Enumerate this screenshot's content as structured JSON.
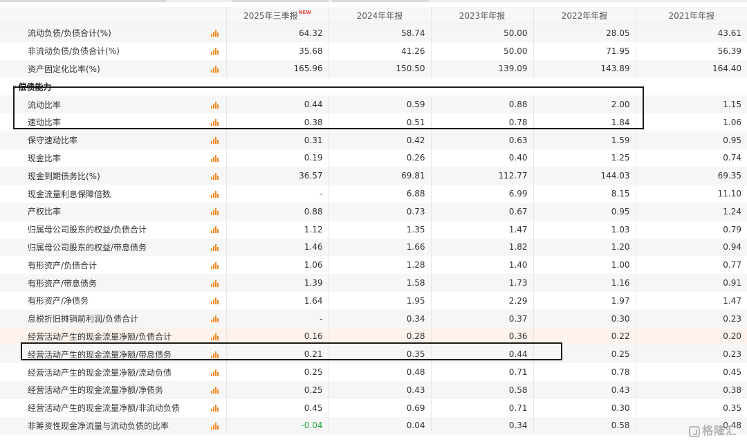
{
  "header": {
    "columns": [
      "2025年三季报",
      "2024年年报",
      "2023年年报",
      "2022年年报",
      "2021年年报"
    ],
    "new_badge": "NEW"
  },
  "section_label": "偿债能力",
  "icons": {
    "row_chart": "bar-chart-icon",
    "section_toggle": "chevron-down-icon"
  },
  "colors": {
    "chart_icon": "#f08a24",
    "negative": "#22a344",
    "new_badge": "#e6483d",
    "highlight_row": "#fdf3ec"
  },
  "watermark": "格隆汇",
  "rows_before": [
    {
      "name": "流动负债/负债合计(%)",
      "values": [
        "64.32",
        "58.74",
        "50.00",
        "28.05",
        "43.61"
      ]
    },
    {
      "name": "非流动负债/负债合计(%)",
      "values": [
        "35.68",
        "41.26",
        "50.00",
        "71.95",
        "56.39"
      ]
    },
    {
      "name": "资产固定化比率(%)",
      "values": [
        "165.96",
        "150.50",
        "139.09",
        "143.89",
        "164.40"
      ]
    }
  ],
  "rows_after": [
    {
      "name": "流动比率",
      "values": [
        "0.44",
        "0.59",
        "0.88",
        "2.00",
        "1.15"
      ]
    },
    {
      "name": "速动比率",
      "values": [
        "0.38",
        "0.51",
        "0.78",
        "1.84",
        "1.06"
      ]
    },
    {
      "name": "保守速动比率",
      "values": [
        "0.31",
        "0.42",
        "0.63",
        "1.59",
        "0.95"
      ]
    },
    {
      "name": "现金比率",
      "values": [
        "0.19",
        "0.26",
        "0.40",
        "1.25",
        "0.74"
      ]
    },
    {
      "name": "现金到期债务比(%)",
      "values": [
        "36.57",
        "69.81",
        "112.77",
        "144.03",
        "69.35"
      ]
    },
    {
      "name": "现金流量利息保障倍数",
      "values": [
        "-",
        "6.88",
        "6.99",
        "8.15",
        "11.10"
      ]
    },
    {
      "name": "产权比率",
      "values": [
        "0.88",
        "0.73",
        "0.67",
        "0.95",
        "1.24"
      ]
    },
    {
      "name": "归属母公司股东的权益/负债合计",
      "values": [
        "1.12",
        "1.35",
        "1.47",
        "1.03",
        "0.79"
      ]
    },
    {
      "name": "归属母公司股东的权益/带息债务",
      "values": [
        "1.46",
        "1.66",
        "1.82",
        "1.20",
        "0.94"
      ]
    },
    {
      "name": "有形资产/负债合计",
      "values": [
        "1.06",
        "1.28",
        "1.40",
        "1.00",
        "0.77"
      ]
    },
    {
      "name": "有形资产/带息债务",
      "values": [
        "1.39",
        "1.58",
        "1.73",
        "1.16",
        "0.91"
      ]
    },
    {
      "name": "有形资产/净债务",
      "values": [
        "1.64",
        "1.95",
        "2.29",
        "1.97",
        "1.47"
      ]
    },
    {
      "name": "息税折旧摊销前利润/负债合计",
      "values": [
        "-",
        "0.34",
        "0.37",
        "0.30",
        "0.23"
      ]
    },
    {
      "name": "经营活动产生的现金流量净额/负债合计",
      "values": [
        "0.16",
        "0.28",
        "0.36",
        "0.22",
        "0.20"
      ]
    },
    {
      "name": "经营活动产生的现金流量净额/带息债务",
      "values": [
        "0.21",
        "0.35",
        "0.44",
        "0.25",
        "0.23"
      ]
    },
    {
      "name": "经营活动产生的现金流量净额/流动负债",
      "values": [
        "0.25",
        "0.48",
        "0.71",
        "0.78",
        "0.45"
      ]
    },
    {
      "name": "经营活动产生的现金流量净额/净债务",
      "values": [
        "0.25",
        "0.43",
        "0.58",
        "0.43",
        "0.38"
      ]
    },
    {
      "name": "经营活动产生的现金流量净额/非流动负债",
      "values": [
        "0.45",
        "0.69",
        "0.71",
        "0.30",
        "0.35"
      ]
    },
    {
      "name": "非筹资性现金净流量与流动负债的比率",
      "values": [
        "-0.04",
        "0.04",
        "0.34",
        "0.58",
        "0.48"
      ]
    }
  ]
}
